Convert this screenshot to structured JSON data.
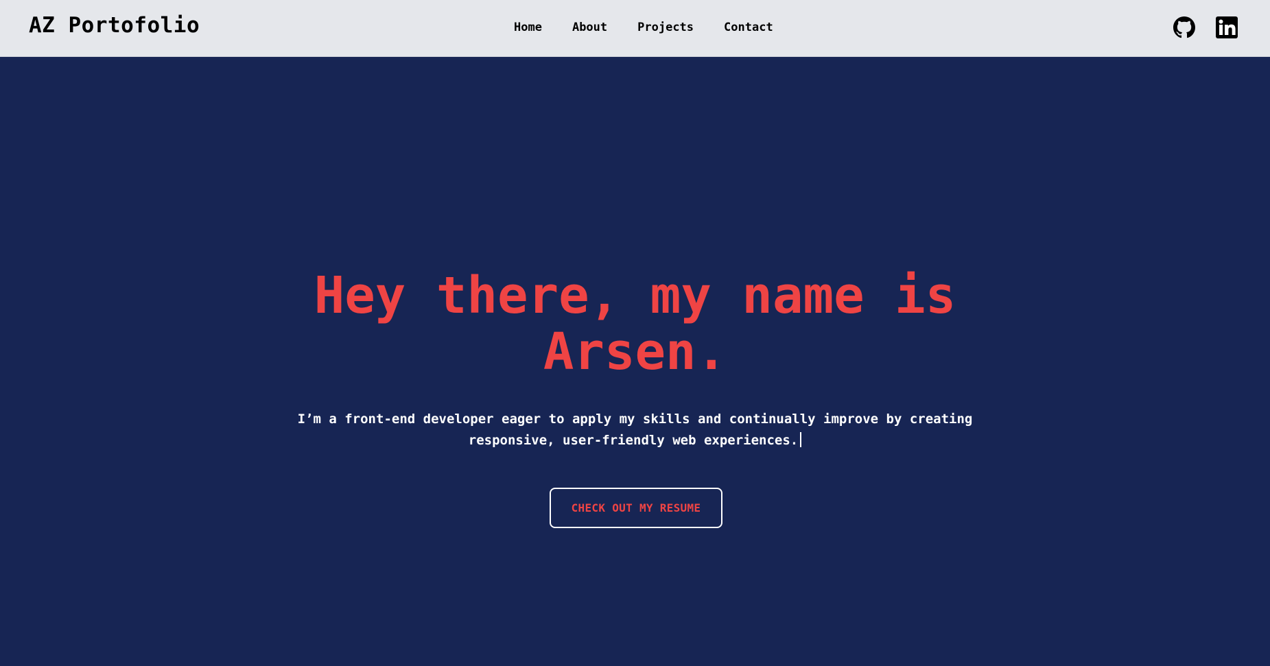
{
  "header": {
    "brand": "AZ Portofolio",
    "nav": [
      {
        "label": "Home"
      },
      {
        "label": "About"
      },
      {
        "label": "Projects"
      },
      {
        "label": "Contact"
      }
    ],
    "social": [
      {
        "icon": "github-icon"
      },
      {
        "icon": "linkedin-icon"
      }
    ]
  },
  "hero": {
    "title_line1": "Hey there, my name is",
    "title_line2": "Arsen.",
    "subtitle_line1": "I’m a front-end developer eager to apply my skills and continually improve by creating",
    "subtitle_line2": "responsive, user-friendly web experiences.",
    "button_label": "CHECK OUT MY RESUME"
  },
  "colors": {
    "header_bg": "#e5e7eb",
    "hero_bg": "#172554",
    "accent": "#ef4444",
    "text_light": "#ffffff"
  }
}
